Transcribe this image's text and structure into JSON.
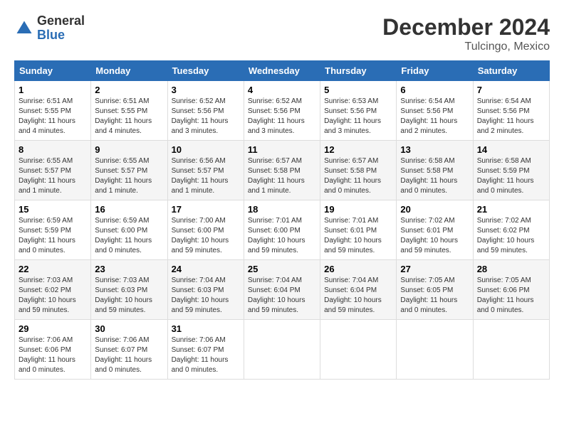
{
  "header": {
    "logo_general": "General",
    "logo_blue": "Blue",
    "month": "December 2024",
    "location": "Tulcingo, Mexico"
  },
  "days_of_week": [
    "Sunday",
    "Monday",
    "Tuesday",
    "Wednesday",
    "Thursday",
    "Friday",
    "Saturday"
  ],
  "weeks": [
    [
      {
        "day": "1",
        "sunrise": "6:51 AM",
        "sunset": "5:55 PM",
        "daylight": "11 hours and 4 minutes."
      },
      {
        "day": "2",
        "sunrise": "6:51 AM",
        "sunset": "5:55 PM",
        "daylight": "11 hours and 4 minutes."
      },
      {
        "day": "3",
        "sunrise": "6:52 AM",
        "sunset": "5:56 PM",
        "daylight": "11 hours and 3 minutes."
      },
      {
        "day": "4",
        "sunrise": "6:52 AM",
        "sunset": "5:56 PM",
        "daylight": "11 hours and 3 minutes."
      },
      {
        "day": "5",
        "sunrise": "6:53 AM",
        "sunset": "5:56 PM",
        "daylight": "11 hours and 3 minutes."
      },
      {
        "day": "6",
        "sunrise": "6:54 AM",
        "sunset": "5:56 PM",
        "daylight": "11 hours and 2 minutes."
      },
      {
        "day": "7",
        "sunrise": "6:54 AM",
        "sunset": "5:56 PM",
        "daylight": "11 hours and 2 minutes."
      }
    ],
    [
      {
        "day": "8",
        "sunrise": "6:55 AM",
        "sunset": "5:57 PM",
        "daylight": "11 hours and 1 minute."
      },
      {
        "day": "9",
        "sunrise": "6:55 AM",
        "sunset": "5:57 PM",
        "daylight": "11 hours and 1 minute."
      },
      {
        "day": "10",
        "sunrise": "6:56 AM",
        "sunset": "5:57 PM",
        "daylight": "11 hours and 1 minute."
      },
      {
        "day": "11",
        "sunrise": "6:57 AM",
        "sunset": "5:58 PM",
        "daylight": "11 hours and 1 minute."
      },
      {
        "day": "12",
        "sunrise": "6:57 AM",
        "sunset": "5:58 PM",
        "daylight": "11 hours and 0 minutes."
      },
      {
        "day": "13",
        "sunrise": "6:58 AM",
        "sunset": "5:58 PM",
        "daylight": "11 hours and 0 minutes."
      },
      {
        "day": "14",
        "sunrise": "6:58 AM",
        "sunset": "5:59 PM",
        "daylight": "11 hours and 0 minutes."
      }
    ],
    [
      {
        "day": "15",
        "sunrise": "6:59 AM",
        "sunset": "5:59 PM",
        "daylight": "11 hours and 0 minutes."
      },
      {
        "day": "16",
        "sunrise": "6:59 AM",
        "sunset": "6:00 PM",
        "daylight": "11 hours and 0 minutes."
      },
      {
        "day": "17",
        "sunrise": "7:00 AM",
        "sunset": "6:00 PM",
        "daylight": "10 hours and 59 minutes."
      },
      {
        "day": "18",
        "sunrise": "7:01 AM",
        "sunset": "6:00 PM",
        "daylight": "10 hours and 59 minutes."
      },
      {
        "day": "19",
        "sunrise": "7:01 AM",
        "sunset": "6:01 PM",
        "daylight": "10 hours and 59 minutes."
      },
      {
        "day": "20",
        "sunrise": "7:02 AM",
        "sunset": "6:01 PM",
        "daylight": "10 hours and 59 minutes."
      },
      {
        "day": "21",
        "sunrise": "7:02 AM",
        "sunset": "6:02 PM",
        "daylight": "10 hours and 59 minutes."
      }
    ],
    [
      {
        "day": "22",
        "sunrise": "7:03 AM",
        "sunset": "6:02 PM",
        "daylight": "10 hours and 59 minutes."
      },
      {
        "day": "23",
        "sunrise": "7:03 AM",
        "sunset": "6:03 PM",
        "daylight": "10 hours and 59 minutes."
      },
      {
        "day": "24",
        "sunrise": "7:04 AM",
        "sunset": "6:03 PM",
        "daylight": "10 hours and 59 minutes."
      },
      {
        "day": "25",
        "sunrise": "7:04 AM",
        "sunset": "6:04 PM",
        "daylight": "10 hours and 59 minutes."
      },
      {
        "day": "26",
        "sunrise": "7:04 AM",
        "sunset": "6:04 PM",
        "daylight": "10 hours and 59 minutes."
      },
      {
        "day": "27",
        "sunrise": "7:05 AM",
        "sunset": "6:05 PM",
        "daylight": "11 hours and 0 minutes."
      },
      {
        "day": "28",
        "sunrise": "7:05 AM",
        "sunset": "6:06 PM",
        "daylight": "11 hours and 0 minutes."
      }
    ],
    [
      {
        "day": "29",
        "sunrise": "7:06 AM",
        "sunset": "6:06 PM",
        "daylight": "11 hours and 0 minutes."
      },
      {
        "day": "30",
        "sunrise": "7:06 AM",
        "sunset": "6:07 PM",
        "daylight": "11 hours and 0 minutes."
      },
      {
        "day": "31",
        "sunrise": "7:06 AM",
        "sunset": "6:07 PM",
        "daylight": "11 hours and 0 minutes."
      },
      null,
      null,
      null,
      null
    ]
  ]
}
